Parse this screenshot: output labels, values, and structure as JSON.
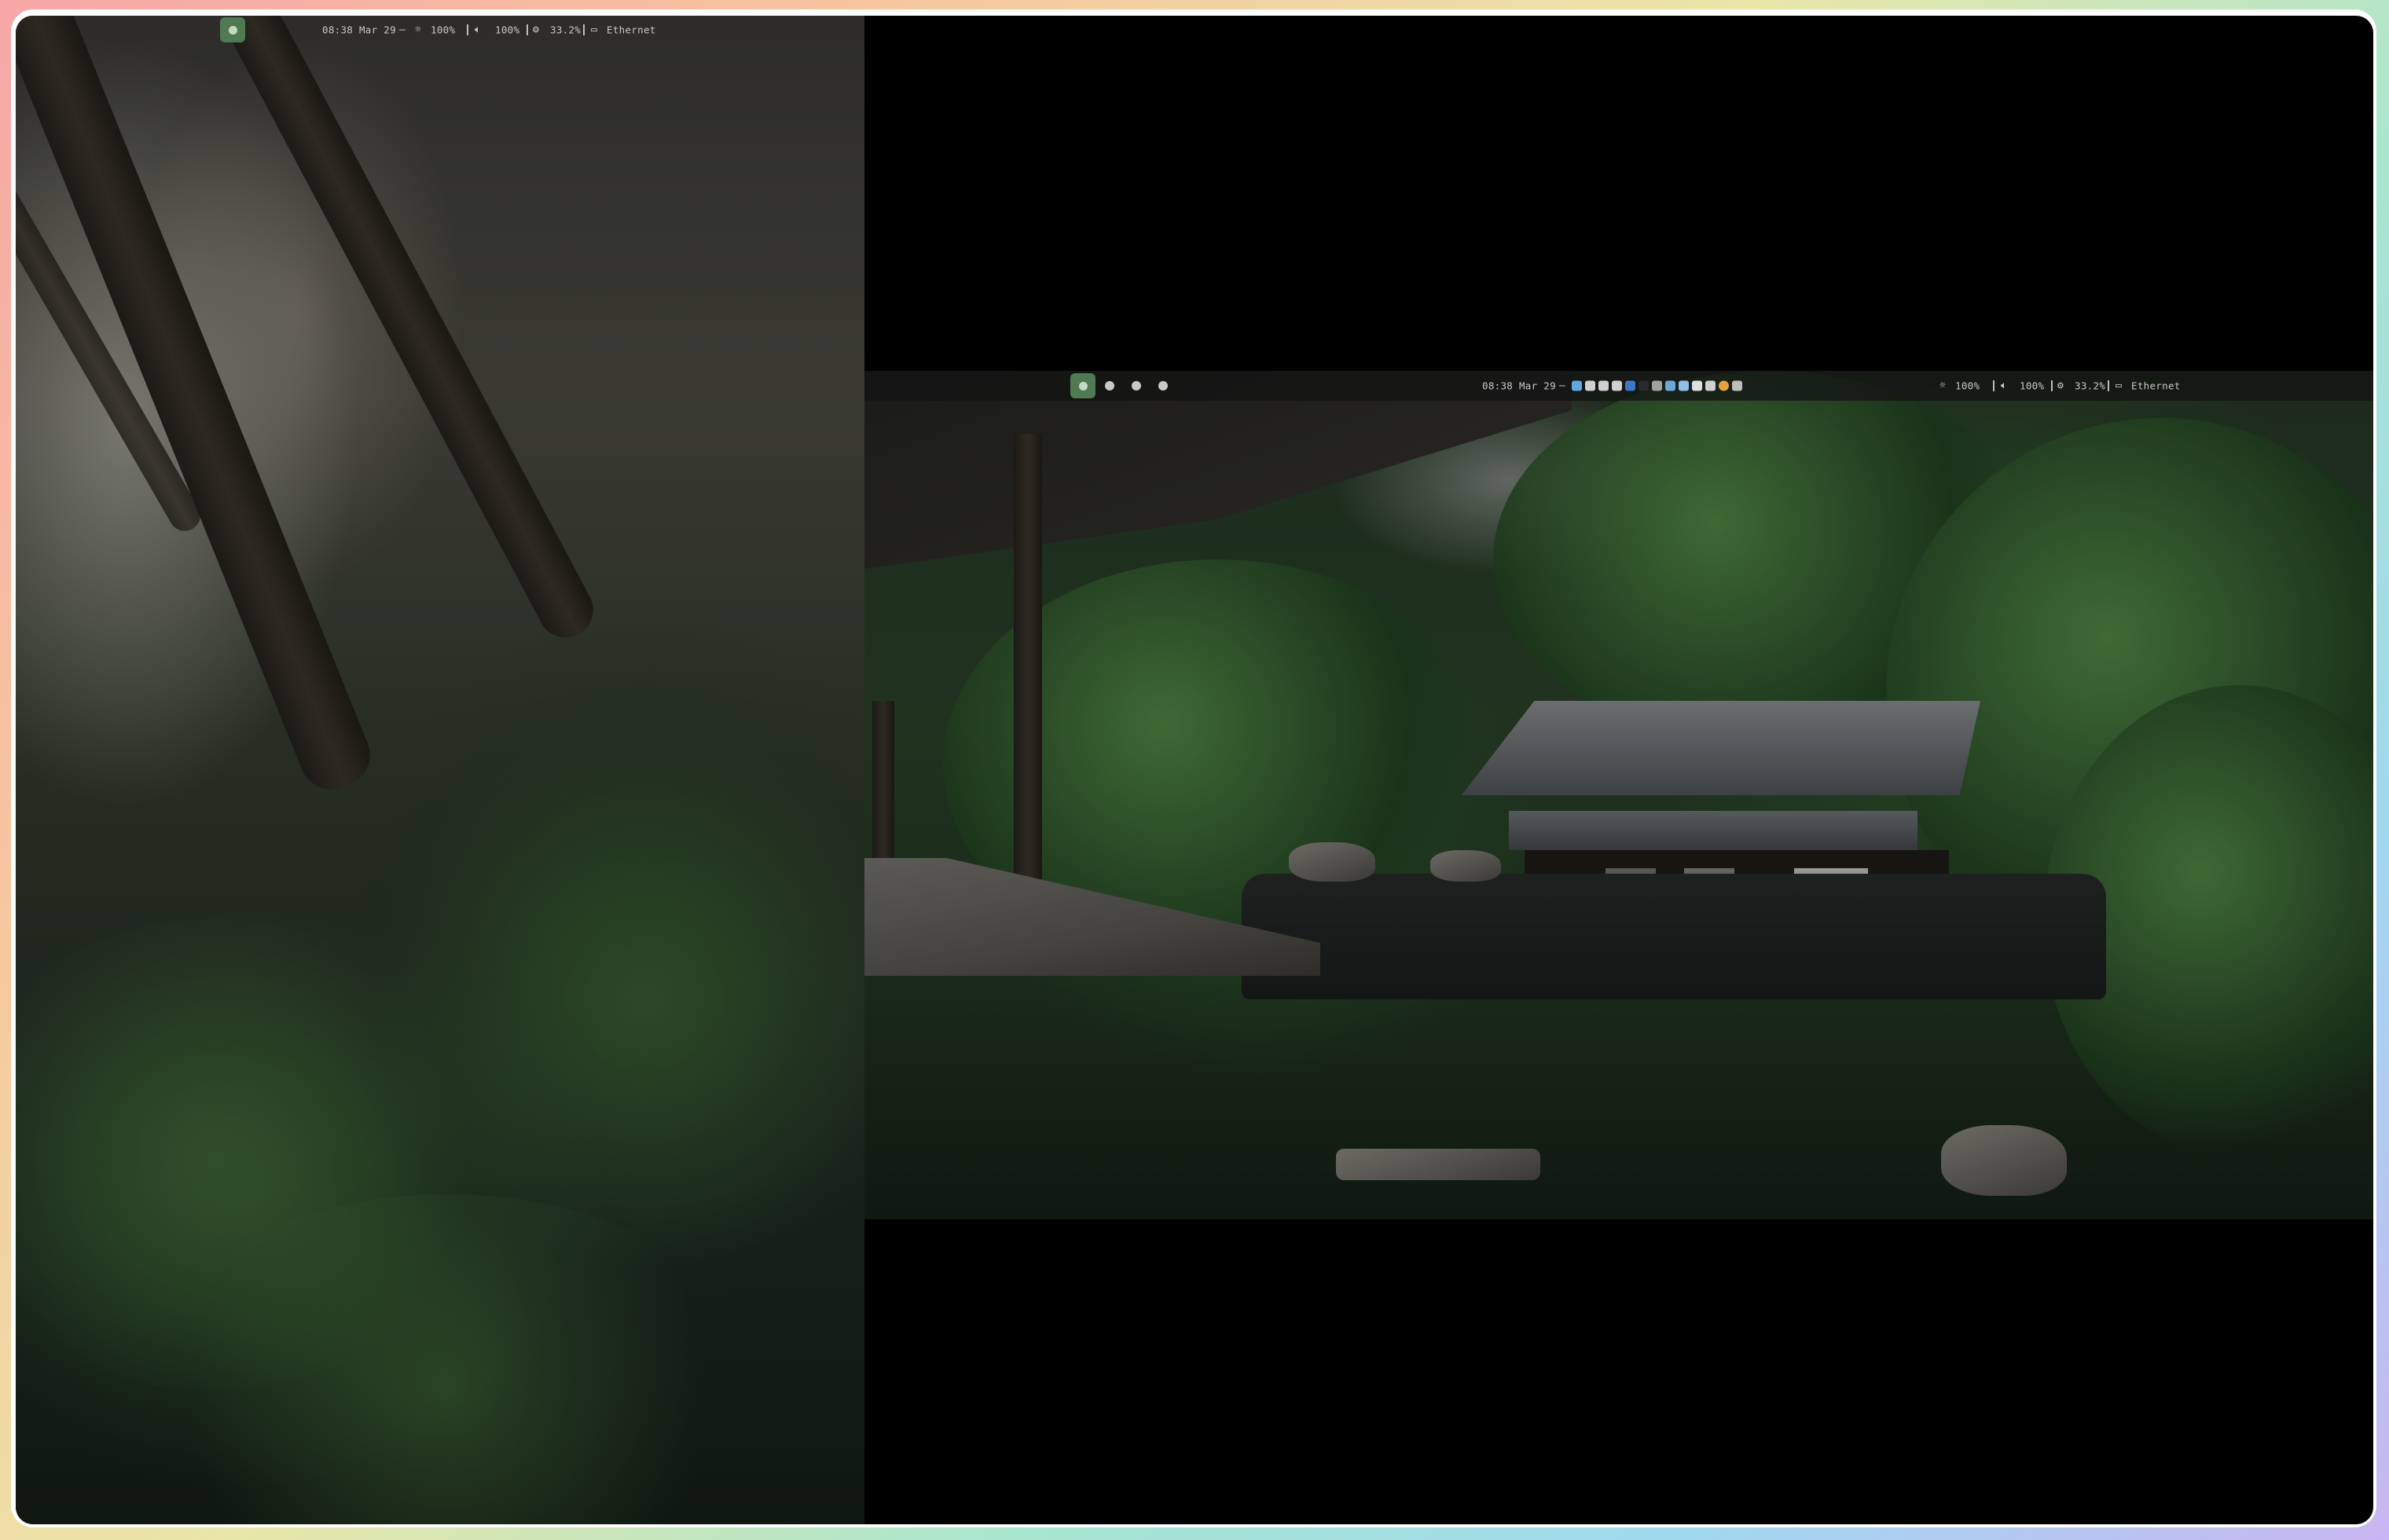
{
  "left_bar": {
    "datetime": "08:38 Mar 29",
    "brightness_icon": "sun-icon",
    "brightness": "100%",
    "volume_icon": "speaker-icon",
    "volume": "100%",
    "cpu_icon": "gear-icon",
    "cpu": "33.2%",
    "network_icon": "monitor-icon",
    "network": "Ethernet"
  },
  "right_bar": {
    "datetime": "08:38 Mar 29",
    "workspaces": [
      {
        "id": 1,
        "active": true
      },
      {
        "id": 2,
        "active": false
      },
      {
        "id": 3,
        "active": false
      },
      {
        "id": 4,
        "active": false
      }
    ],
    "tray_icons": [
      {
        "name": "files-tray-icon",
        "color": "#5fa8e0"
      },
      {
        "name": "cursor-tray-icon",
        "color": "#d0d0d0"
      },
      {
        "name": "clipboard-tray-icon",
        "color": "#d0d0d0"
      },
      {
        "name": "mouse-tray-icon",
        "color": "#d0d0d0"
      },
      {
        "name": "app-tray-icon",
        "color": "#3b78c9"
      },
      {
        "name": "circle-tray-icon",
        "color": "#2a2a2a"
      },
      {
        "name": "camera-tray-icon",
        "color": "#a0a0a0"
      },
      {
        "name": "steam-tray-icon",
        "color": "#6aa7d8"
      },
      {
        "name": "doc-tray-icon",
        "color": "#8fbfe8"
      },
      {
        "name": "y-tray-icon",
        "color": "#e0e0e0"
      },
      {
        "name": "mic-tray-icon",
        "color": "#d0d0d0"
      },
      {
        "name": "chrome-tray-icon",
        "color": "#e6a23c"
      },
      {
        "name": "speaker-tray-icon",
        "color": "#bdbdbd"
      }
    ],
    "brightness": "100%",
    "volume": "100%",
    "cpu": "33.2%",
    "network": "Ethernet"
  },
  "colors": {
    "accent": "#4f7a52",
    "bar_text": "#c8c8c8",
    "bar_bg": "#121212"
  }
}
